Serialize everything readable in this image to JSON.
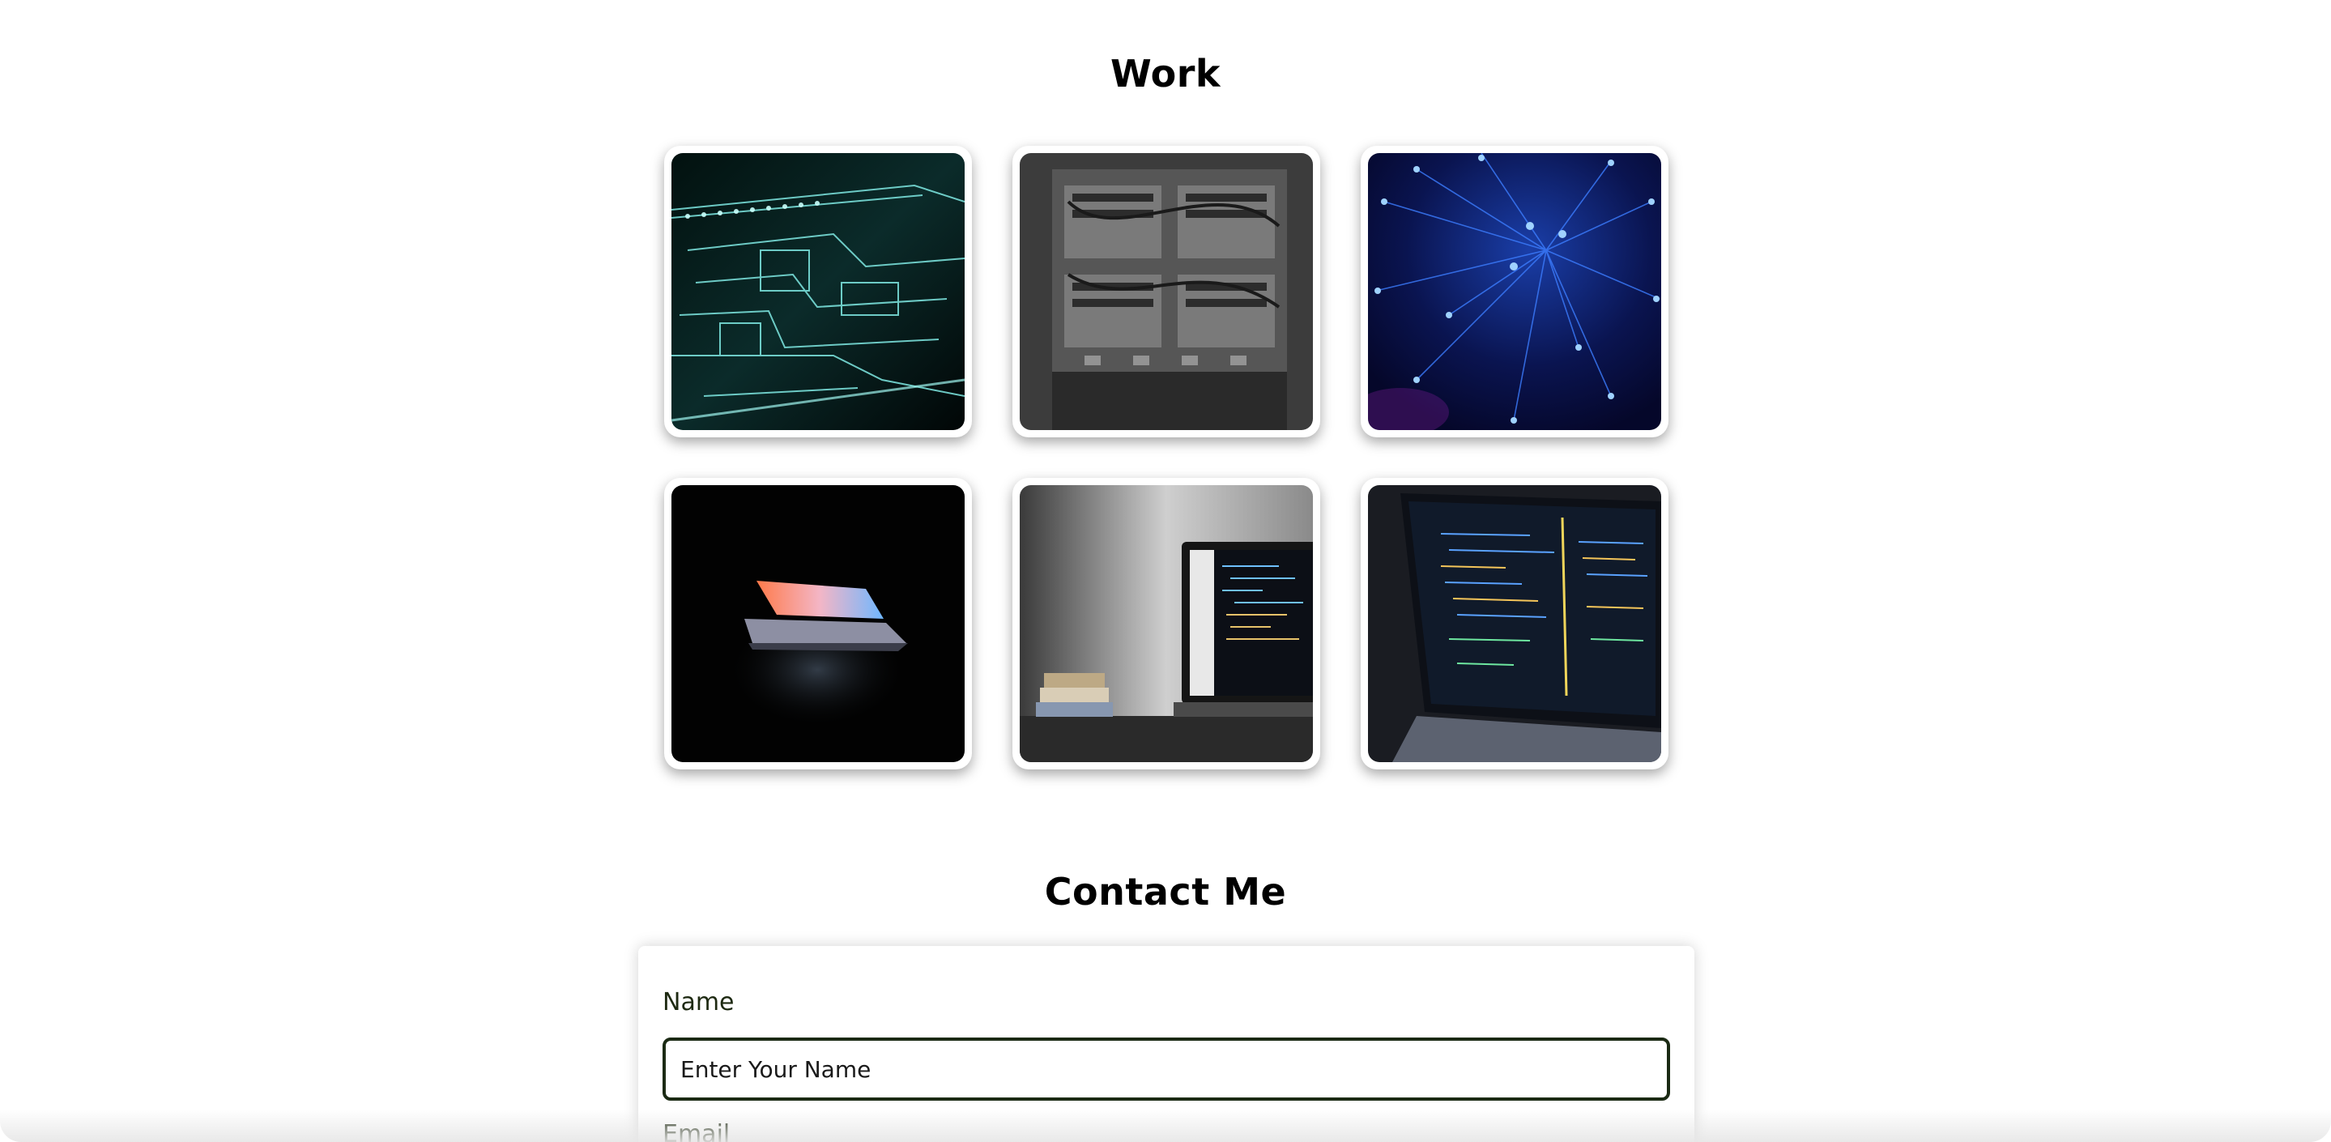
{
  "work": {
    "title": "Work",
    "items": [
      {
        "name": "circuit-board-image"
      },
      {
        "name": "server-rack-image"
      },
      {
        "name": "fiber-optics-image"
      },
      {
        "name": "laptop-dark-image"
      },
      {
        "name": "laptop-desk-code-image"
      },
      {
        "name": "laptop-code-editor-image"
      }
    ]
  },
  "contact": {
    "title": "Contact Me",
    "name_label": "Name",
    "name_placeholder": "Enter Your Name",
    "email_label": "Email"
  },
  "colors": {
    "background": "#ffffff",
    "input_border": "#1b2a14",
    "label_text": "#1e2a12"
  }
}
